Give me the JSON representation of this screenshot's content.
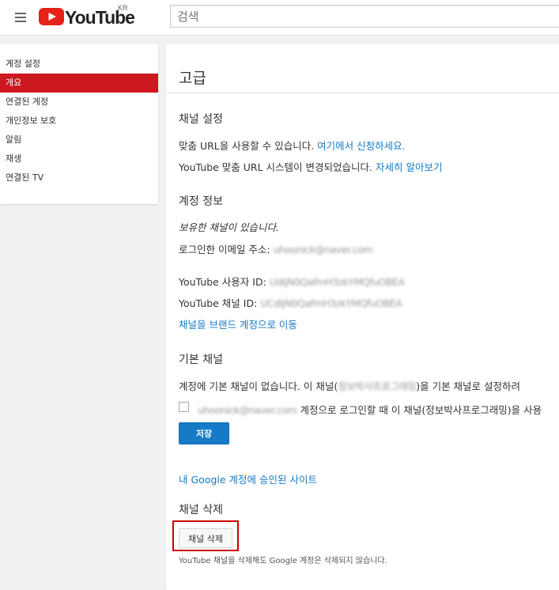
{
  "masthead": {
    "logo_text": "YouTube",
    "region": "KR",
    "search_placeholder": "검색"
  },
  "sidebar": {
    "items": [
      {
        "label": "계정 설정"
      },
      {
        "label": "개요"
      },
      {
        "label": "연결된 계정"
      },
      {
        "label": "개인정보 보호"
      },
      {
        "label": "알림"
      },
      {
        "label": "재생"
      },
      {
        "label": "연결된 TV"
      }
    ],
    "active_index": 1
  },
  "main": {
    "title": "고급",
    "channel_settings": {
      "heading": "채널 설정",
      "custom_url_text": "맞춤 URL을 사용할 수 있습니다. ",
      "custom_url_link": "여기에서 신청하세요.",
      "url_system_text": "YouTube 맞춤 URL 시스템이 변경되었습니다. ",
      "url_system_link": "자세히 알아보기"
    },
    "account_info": {
      "heading": "계정 정보",
      "has_channel": "보유한 채널이 있습니다.",
      "email_label": "로그인한 이메일 주소: ",
      "email_value": "uhoonick@naver.com",
      "user_id_label": "YouTube 사용자 ID: ",
      "user_id_value": "UdIjN0QafmH3zkYMQfuOBEA",
      "channel_id_label": "YouTube 채널 ID: ",
      "channel_id_value": "UCdIjN0QafmH3zkYMQfuOBEA",
      "move_to_brand_link": "채널을 브랜드 계정으로 이동"
    },
    "default_channel": {
      "heading": "기본 채널",
      "text_before": "계정에 기본 채널이 없습니다. 이 채널(",
      "channel_name": "정보박사프로그래밍",
      "text_after": ")을 기본 채널로 설정하려",
      "checkbox_email": "uhoonick@naver.com",
      "checkbox_text": " 계정으로 로그인할 때 이 채널(정보박사프로그래밍)을 사용",
      "save_label": "저장"
    },
    "google_sites_link": "내 Google 계정에 승인된 사이트",
    "delete_channel": {
      "heading": "채널 삭제",
      "button_label": "채널 삭제",
      "note": "YouTube 채널을 삭제해도 Google 계정은 삭제되지 않습니다."
    }
  },
  "colors": {
    "accent_red": "#cc181e",
    "link_blue": "#167ac6",
    "highlight_frame": "#cc0000"
  }
}
